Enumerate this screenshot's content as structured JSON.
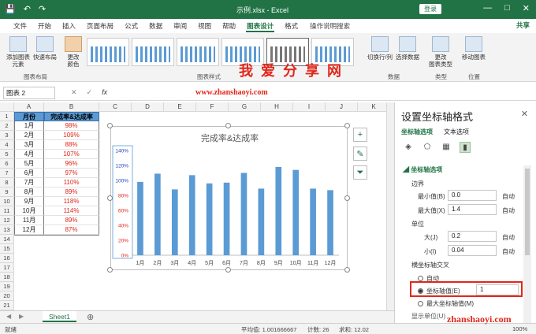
{
  "titlebar": {
    "document_title": "示例.xlsx - Excel",
    "login_label": "登录",
    "window_buttons": [
      "—",
      "□",
      "✕"
    ]
  },
  "tabs": [
    "文件",
    "开始",
    "插入",
    "页面布局",
    "公式",
    "数据",
    "审阅",
    "视图",
    "帮助",
    "图表设计",
    "格式"
  ],
  "active_tab": "图表设计",
  "tell_me": "操作说明搜索",
  "share_label": "共享",
  "ribbon": {
    "add_element": "添加图表\n元素",
    "quick_layout": "快速布局",
    "change_colors": "更改\n颜色",
    "switch_row_col": "切换行/列",
    "select_data": "选择数据",
    "change_type": "更改\n图表类型",
    "move_chart": "移动图表",
    "group_layouts": "图表布局",
    "group_styles": "图表样式",
    "group_data": "数据",
    "group_type": "类型",
    "group_location": "位置"
  },
  "watermark_text": "我爱分享网",
  "watermark_url": "www.zhanshaoyi.com",
  "namebox": "图表 2",
  "fx_label": "fx",
  "columns": [
    "A",
    "B",
    "C",
    "D",
    "E",
    "F",
    "G",
    "H",
    "I",
    "J",
    "K"
  ],
  "rows": [
    "1",
    "2",
    "3",
    "4",
    "5",
    "6",
    "7",
    "8",
    "9",
    "10",
    "11",
    "12",
    "13",
    "14",
    "15",
    "16",
    "17",
    "18",
    "19",
    "20",
    "21"
  ],
  "table": {
    "headers": [
      "月份",
      "完成率&达成率"
    ],
    "months": [
      "1月",
      "2月",
      "3月",
      "4月",
      "5月",
      "6月",
      "7月",
      "8月",
      "9月",
      "10月",
      "11月",
      "12月"
    ],
    "rates": [
      "98%",
      "109%",
      "88%",
      "107%",
      "96%",
      "97%",
      "110%",
      "89%",
      "118%",
      "114%",
      "89%",
      "87%"
    ]
  },
  "chart_data": {
    "type": "bar",
    "title": "完成率&达成率",
    "categories": [
      "1月",
      "2月",
      "3月",
      "4月",
      "5月",
      "6月",
      "7月",
      "8月",
      "9月",
      "10月",
      "11月",
      "12月"
    ],
    "values": [
      0.98,
      1.09,
      0.88,
      1.07,
      0.96,
      0.97,
      1.1,
      0.89,
      1.18,
      1.14,
      0.89,
      0.87
    ],
    "ylim": [
      0,
      1.4
    ],
    "yticks": [
      "0%",
      "20%",
      "40%",
      "60%",
      "80%",
      "100%",
      "120%",
      "140%"
    ],
    "bar_color": "#5b9bd5"
  },
  "sheet_tab": "Sheet1",
  "status": {
    "ready": "就绪",
    "average": "平均值: 1.001666667",
    "count": "计数: 26",
    "sum": "求和: 12.02",
    "zoom": "100%"
  },
  "pane": {
    "title": "设置坐标轴格式",
    "tab_options": "坐标轴选项",
    "tab_text": "文本选项",
    "section": "坐标轴选项",
    "bounds_label": "边界",
    "min_label": "最小值(B)",
    "min_value": "0.0",
    "max_label": "最大值(X)",
    "max_value": "1.4",
    "units_label": "单位",
    "major_label": "大(J)",
    "major_value": "0.2",
    "minor_label": "小(I)",
    "minor_value": "0.04",
    "cross_label": "横坐标轴交叉",
    "auto_label": "自动",
    "axis_value_label": "坐标轴值(E)",
    "axis_value": "1",
    "max_axis_label": "最大坐标轴值(M)",
    "display_units": "显示单位(U)"
  },
  "watermark2": "zhanshaoyi.com"
}
